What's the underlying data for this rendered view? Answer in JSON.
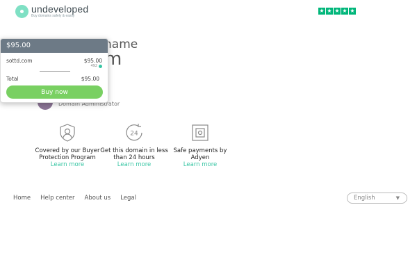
{
  "brand": {
    "name": "undeveloped",
    "tagline": "Buy domains safely & easily",
    "accent": "#38c6a4",
    "logo_color": "#7fe0c4"
  },
  "rating": {
    "stars": 5,
    "star_color": "#00b67a"
  },
  "page": {
    "title_line1": "name",
    "title_line2": "m"
  },
  "seller": {
    "role": "Domain Administrator"
  },
  "features": [
    {
      "icon": "buyer-protection-icon",
      "text": "Covered by our Buyer Protection Program",
      "link": "Learn more"
    },
    {
      "icon": "24-hour-clock-icon",
      "text": "Get this domain in less than 24 hours",
      "link": "Learn more"
    },
    {
      "icon": "safe-payment-icon",
      "text": "Safe payments by Adyen",
      "link": "Learn more"
    }
  ],
  "cart": {
    "header_price": "$95.00",
    "domain": "sottd.com",
    "domain_price": "$95.00",
    "domain_subprice": "492",
    "total_label": "Total",
    "total_price": "$95.00",
    "buy_label": "Buy now",
    "buy_color": "#79d062",
    "header_color": "#6d7a86"
  },
  "footer": {
    "links": [
      "Home",
      "Help center",
      "About us",
      "Legal"
    ],
    "language": "English"
  }
}
